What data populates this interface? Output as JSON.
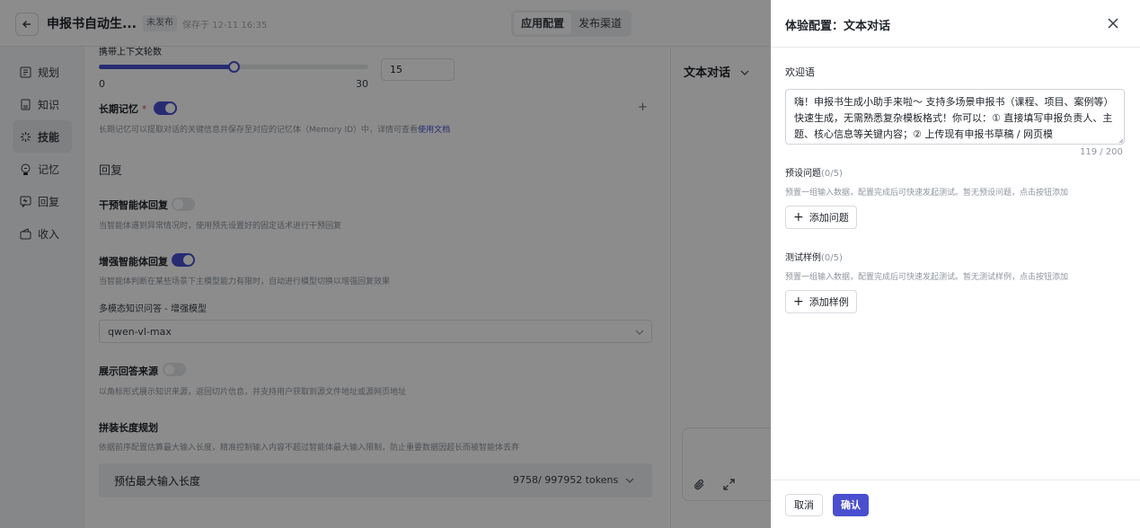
{
  "header": {
    "title": "申报书自动生...",
    "status": "未发布",
    "saved": "保存于 12-11 16:35",
    "tabs": [
      "应用配置",
      "发布渠道"
    ]
  },
  "nav": {
    "items": [
      {
        "label": "规划",
        "icon": "grid-icon"
      },
      {
        "label": "知识",
        "icon": "book-icon"
      },
      {
        "label": "技能",
        "icon": "skill-icon"
      },
      {
        "label": "记忆",
        "icon": "memory-icon"
      },
      {
        "label": "回复",
        "icon": "reply-icon"
      },
      {
        "label": "收入",
        "icon": "income-icon"
      }
    ],
    "active": "技能"
  },
  "config": {
    "context_rounds_label": "携带上下文轮数",
    "slider_min": "0",
    "slider_max": "30",
    "slider_value": "15",
    "slider_fraction": 0.5,
    "long_memory_title": "长期记忆",
    "long_memory_required": "*",
    "long_memory_enabled": true,
    "long_memory_desc": "长期记忆可以提取对话的关键信息并保存至对应的记忆体（Memory ID）中，详情可查看",
    "long_memory_link": "使用文档",
    "add_symbol": "+",
    "reply_section": "回复",
    "intervene_title": "干预智能体回复",
    "intervene_enabled": false,
    "intervene_desc": "当智能体遇到异常情况时，使用预先设置好的固定话术进行干预回复",
    "enhance_title": "增强智能体回复",
    "enhance_enabled": true,
    "enhance_desc": "当智能体判断在某些场景下主模型能力有限时，自动进行模型切换以增强回复效果",
    "model_label": "多模态知识问答 - 增强模型",
    "model_value": "qwen-vl-max",
    "source_title": "展示回答来源",
    "source_enabled": false,
    "source_desc": "以角标形式展示知识来源，返回切片信息，并支持用户获取到源文件地址或源网页地址",
    "concat_title": "拼装长度规划",
    "concat_desc": "依据前序配置估算最大输入长度，精准控制输入内容不超过智能体最大输入限制，防止重要数据因超长而被智能体丢弃",
    "estimate_label": "预估最大输入长度",
    "estimate_value": "9758/ 997952 tokens"
  },
  "chat": {
    "mode": "文本对话"
  },
  "drawer": {
    "title": "体验配置：文本对话",
    "welcome_label": "欢迎语",
    "welcome_text": "嗨！申报书生成小助手来啦～ 支持多场景申报书（课程、项目、案例等）快速生成，无需熟悉复杂模板格式！你可以：① 直接填写申报负责人、主题、核心信息等关键内容；② 上传现有申报书草稿 / 网页模",
    "welcome_count": "119 / 200",
    "preset_label": "预设问题",
    "preset_count": "(0/5)",
    "preset_desc": "预置一组输入数据，配置完成后可快速发起测试。暂无预设问题，点击按钮添加",
    "preset_btn": "添加问题",
    "sample_label": "测试样例",
    "sample_count": "(0/5)",
    "sample_desc": "预置一组输入数据，配置完成后可快速发起测试。暂无测试样例，点击按钮添加",
    "sample_btn": "添加样例",
    "cancel": "取消",
    "confirm": "确认"
  }
}
